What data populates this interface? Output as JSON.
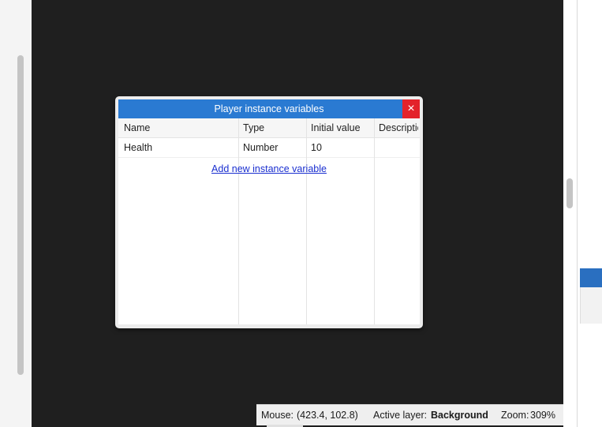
{
  "dialog": {
    "title": "Player instance variables",
    "close_icon": "×",
    "columns": [
      "Name",
      "Type",
      "Initial value",
      "Description"
    ],
    "rows": [
      {
        "name": "Health",
        "type": "Number",
        "initial_value": "10",
        "description": ""
      }
    ],
    "add_link": "Add new instance variable"
  },
  "status": {
    "mouse_label": "Mouse:",
    "mouse_value": "(423.4, 102.8)",
    "layer_label": "Active layer:",
    "layer_value": "Background",
    "zoom_label": "Zoom:",
    "zoom_value": "309%"
  },
  "colors": {
    "titlebar": "#2a7ad2",
    "close": "#e3232b",
    "link": "#1a2fd0",
    "canvas": "#1f1f1f"
  }
}
